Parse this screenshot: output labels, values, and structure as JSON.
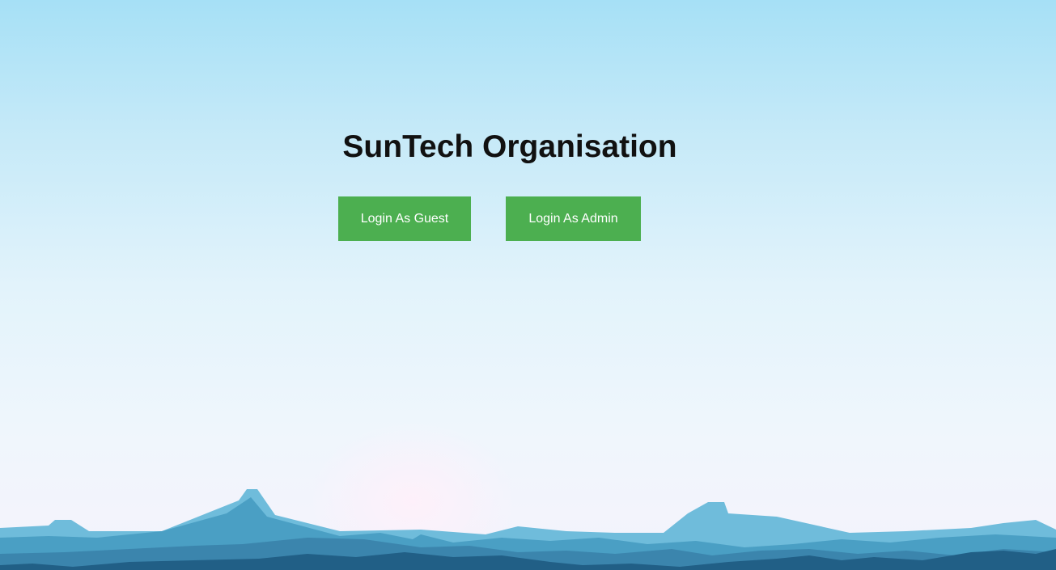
{
  "page": {
    "title": "SunTech Organisation"
  },
  "actions": {
    "guest_label": "Login As Guest",
    "admin_label": "Login As Admin"
  },
  "colors": {
    "button_bg": "#4caf50",
    "button_text": "#ffffff",
    "title_text": "#111111",
    "sky_top": "#a6e0f6",
    "sky_bottom": "#f1f2fb",
    "mountain_light": "#5fb3d4",
    "mountain_mid": "#3f8fb5",
    "mountain_dark": "#1f5a80"
  }
}
